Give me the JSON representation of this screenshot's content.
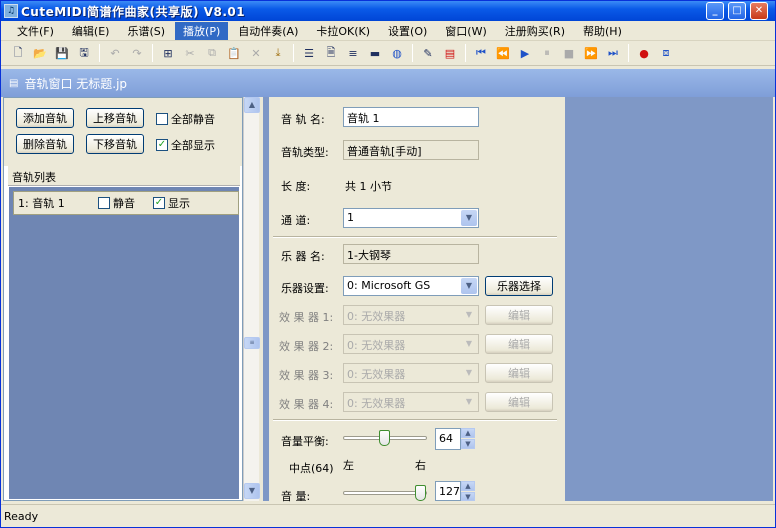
{
  "window": {
    "title": "CuteMIDI简谱作曲家(共享版) V8.01",
    "app_icon_glyph": "♫"
  },
  "menu": [
    {
      "label": "文件(F)"
    },
    {
      "label": "编辑(E)"
    },
    {
      "label": "乐谱(S)"
    },
    {
      "label": "播放(P)"
    },
    {
      "label": "自动伴奏(A)"
    },
    {
      "label": "卡拉OK(K)"
    },
    {
      "label": "设置(O)"
    },
    {
      "label": "窗口(W)"
    },
    {
      "label": "注册购买(R)"
    },
    {
      "label": "帮助(H)"
    }
  ],
  "active_menu": "播放(P)",
  "toolbar_icons": [
    "new-icon",
    "open-icon",
    "save-icon",
    "save-all-icon",
    "undo-icon",
    "redo-icon",
    "insert-icon",
    "cut-icon",
    "copy-icon",
    "paste-icon",
    "delete-icon",
    "download-icon",
    "list-icon",
    "page-icon",
    "lines-icon",
    "bar-icon",
    "globe-icon",
    "pen-icon",
    "sheet-icon",
    "first-icon",
    "rewind-icon",
    "play-icon",
    "pause-icon",
    "stop-icon",
    "forward-icon",
    "last-icon",
    "record-icon",
    "midi-icon"
  ],
  "doc": {
    "title": "音轨窗口  无标题.jp"
  },
  "left": {
    "add_track": "添加音轨",
    "move_up": "上移音轨",
    "mute_all": "全部静音",
    "mute_all_checked": false,
    "delete_track": "删除音轨",
    "move_down": "下移音轨",
    "show_all": "全部显示",
    "show_all_checked": true,
    "track_list_header": "音轨列表",
    "tracks": [
      {
        "name": "1: 音轨 1",
        "mute_label": "静音",
        "mute": false,
        "show_label": "显示",
        "show": true
      }
    ]
  },
  "props": {
    "track_name_label": "音 轨 名:",
    "track_name": "音轨 1",
    "track_type_label": "音轨类型:",
    "track_type": "普通音轨[手动]",
    "length_label": "长    度:",
    "length": "共 1 小节",
    "channel_label": "通    道:",
    "channel": "1",
    "instrument_name_label": "乐 器 名:",
    "instrument_name": "1-大钢琴",
    "instrument_setting_label": "乐器设置:",
    "instrument_setting": "0: Microsoft GS",
    "instrument_select": "乐器选择",
    "effects": [
      {
        "label": "效 果 器 1:",
        "value": "0: 无效果器",
        "edit": "编辑"
      },
      {
        "label": "效 果 器 2:",
        "value": "0: 无效果器",
        "edit": "编辑"
      },
      {
        "label": "效 果 器 3:",
        "value": "0: 无效果器",
        "edit": "编辑"
      },
      {
        "label": "效 果 器 4:",
        "value": "0: 无效果器",
        "edit": "编辑"
      }
    ],
    "balance_label": "音量平衡:",
    "balance_value": "64",
    "balance_center": "中点(64)",
    "balance_left": "左",
    "balance_right": "右",
    "volume_label": "音    量:",
    "volume_value": "127"
  },
  "status": {
    "text": "Ready"
  }
}
